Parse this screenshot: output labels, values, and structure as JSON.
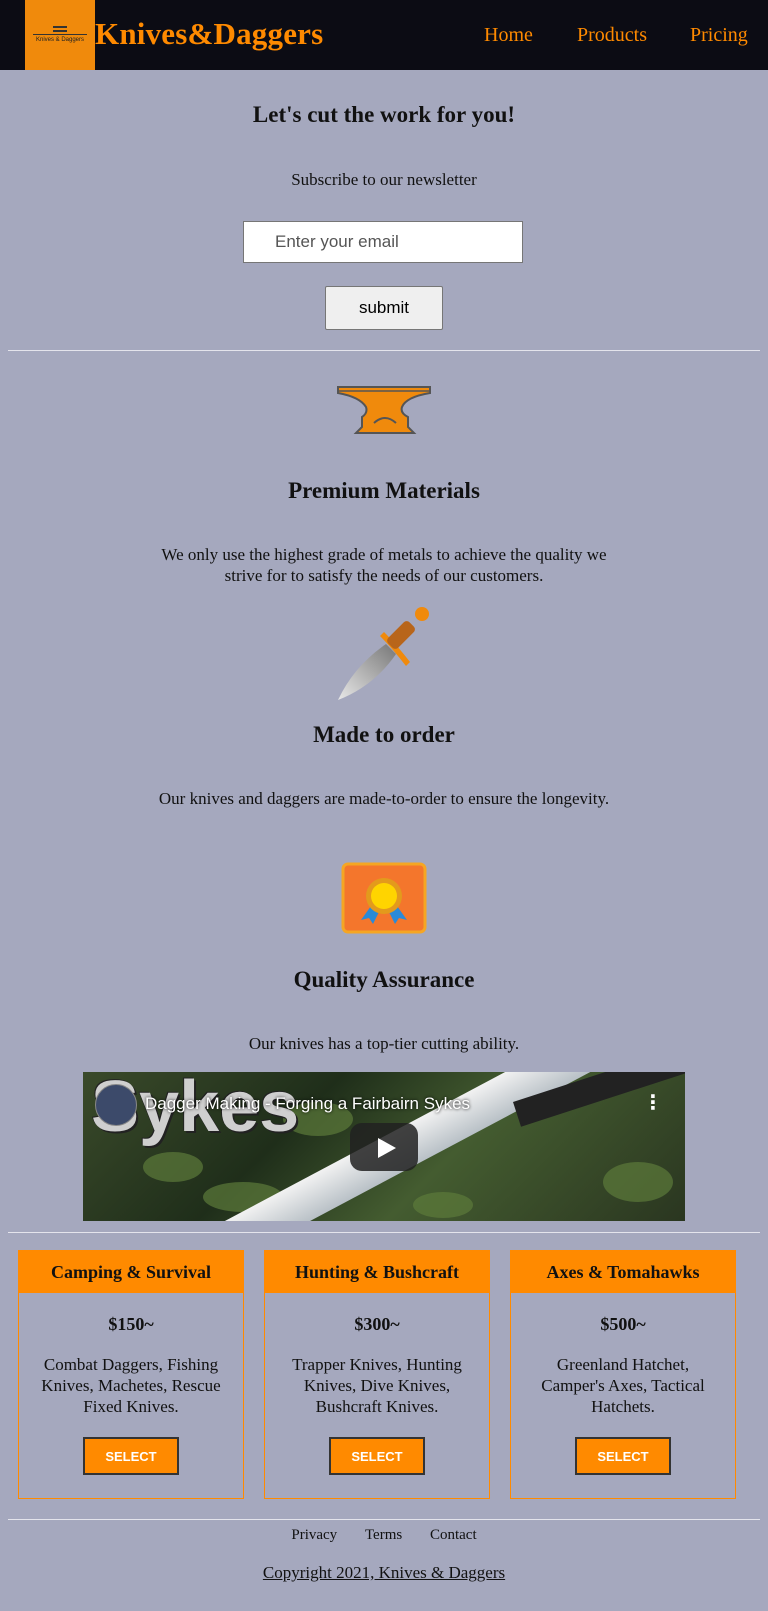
{
  "header": {
    "logo_text": "Knives & Daggers",
    "brand": "Knives&Daggers",
    "nav": [
      "Home",
      "Products",
      "Pricing"
    ]
  },
  "newsletter": {
    "title": "Let's cut the work for you!",
    "subtitle": "Subscribe to our newsletter",
    "email_placeholder": "Enter your email",
    "submit_label": "submit"
  },
  "features": [
    {
      "icon": "anvil-icon",
      "title": "Premium Materials",
      "description": "We only use the highest grade of metals to achieve the quality we strive for to satisfy the needs of our customers."
    },
    {
      "icon": "dagger-icon",
      "title": "Made to order",
      "description": "Our knives and daggers are made-to-order to ensure the longevity."
    },
    {
      "icon": "award-badge-icon",
      "title": "Quality Assurance",
      "description": "Our knives has a top-tier cutting ability."
    }
  ],
  "video": {
    "title": "Dagger Making - Forging a Fairbairn Sykes",
    "thumbnail_text": "Sykes"
  },
  "pricing": [
    {
      "name": "Camping & Survival",
      "price": "$150~",
      "items": "Combat Daggers, Fishing Knives, Machetes, Rescue Fixed Knives.",
      "button": "SELECT"
    },
    {
      "name": "Hunting & Bushcraft",
      "price": "$300~",
      "items": "Trapper Knives, Hunting Knives, Dive Knives, Bushcraft Knives.",
      "button": "SELECT"
    },
    {
      "name": "Axes & Tomahawks",
      "price": "$500~",
      "items": "Greenland Hatchet, Camper's Axes, Tactical Hatchets.",
      "button": "SELECT"
    }
  ],
  "footer": {
    "links": [
      "Privacy",
      "Terms",
      "Contact"
    ],
    "copyright": "Copyright 2021, Knives & Daggers"
  },
  "colors": {
    "accent": "#ff8a00",
    "background": "#a5a8be",
    "header": "#0c0c14"
  }
}
